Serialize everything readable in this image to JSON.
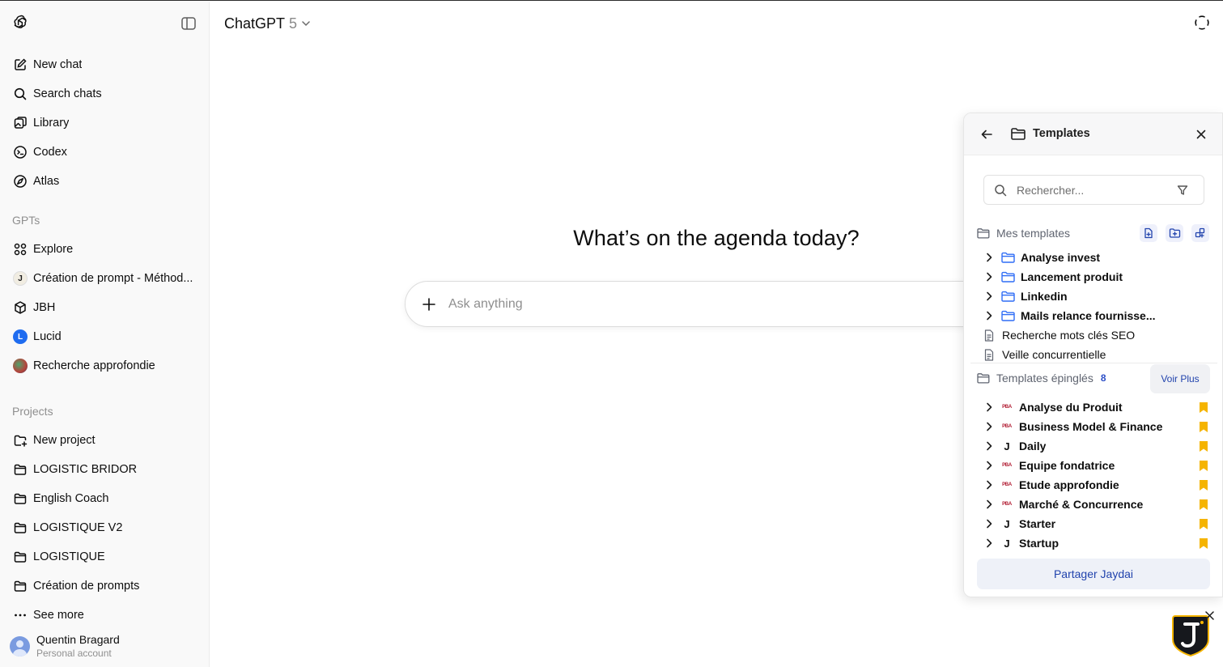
{
  "sidebar": {
    "nav": [
      {
        "label": "New chat",
        "icon": "new-chat-icon"
      },
      {
        "label": "Search chats",
        "icon": "search-icon"
      },
      {
        "label": "Library",
        "icon": "library-icon"
      },
      {
        "label": "Codex",
        "icon": "codex-icon"
      },
      {
        "label": "Atlas",
        "icon": "atlas-icon"
      }
    ],
    "gpts_heading": "GPTs",
    "gpts": [
      {
        "label": "Explore",
        "icon": "explore-grid-icon"
      },
      {
        "label": "Création de prompt - Méthod...",
        "icon": "gpt-avatar-j"
      },
      {
        "label": "JBH",
        "icon": "cube-icon"
      },
      {
        "label": "Lucid",
        "icon": "gpt-avatar-lucid"
      },
      {
        "label": "Recherche approfondie",
        "icon": "gpt-avatar-recherche"
      }
    ],
    "projects_heading": "Projects",
    "projects": [
      {
        "label": "New project",
        "icon": "new-folder-icon"
      },
      {
        "label": "LOGISTIC BRIDOR",
        "icon": "folder-icon"
      },
      {
        "label": "English Coach",
        "icon": "folder-icon"
      },
      {
        "label": "LOGISTIQUE V2",
        "icon": "folder-icon"
      },
      {
        "label": "LOGISTIQUE",
        "icon": "folder-icon"
      },
      {
        "label": "Création de prompts",
        "icon": "folder-icon"
      },
      {
        "label": "See more",
        "icon": "more-dots-icon"
      }
    ],
    "user": {
      "name": "Quentin Bragard",
      "account": "Personal account"
    }
  },
  "header": {
    "model_name": "ChatGPT",
    "model_version": "5"
  },
  "main": {
    "headline": "What’s on the agenda today?",
    "composer_placeholder": "Ask anything"
  },
  "templates_panel": {
    "title": "Templates",
    "search_placeholder": "Rechercher...",
    "mine_heading": "Mes templates",
    "mine": [
      {
        "label": "Analyse invest",
        "type": "folder"
      },
      {
        "label": "Lancement produit",
        "type": "folder"
      },
      {
        "label": "Linkedin",
        "type": "folder"
      },
      {
        "label": "Mails relance fournisse...",
        "type": "folder"
      },
      {
        "label": "Recherche mots clés SEO",
        "type": "file"
      },
      {
        "label": "Veille concurrentielle",
        "type": "file"
      }
    ],
    "pinned_heading": "Templates épinglés",
    "pinned_count": "8",
    "see_more": "Voir Plus",
    "pinned": [
      {
        "label": "Analyse du Produit",
        "source": "PBA"
      },
      {
        "label": "Business Model & Finance",
        "source": "PBA"
      },
      {
        "label": "Daily",
        "source": "J"
      },
      {
        "label": "Equipe fondatrice",
        "source": "PBA"
      },
      {
        "label": "Etude approfondie",
        "source": "PBA"
      },
      {
        "label": "Marché & Concurrence",
        "source": "PBA"
      },
      {
        "label": "Starter",
        "source": "J"
      },
      {
        "label": "Startup",
        "source": "J"
      }
    ],
    "share_label": "Partager Jaydai"
  },
  "colors": {
    "sidebar_bg": "#f9f9f9",
    "accent_blue": "#2143ad",
    "folder_blue": "#2f6df6",
    "bookmark_yellow": "#f5b400"
  }
}
